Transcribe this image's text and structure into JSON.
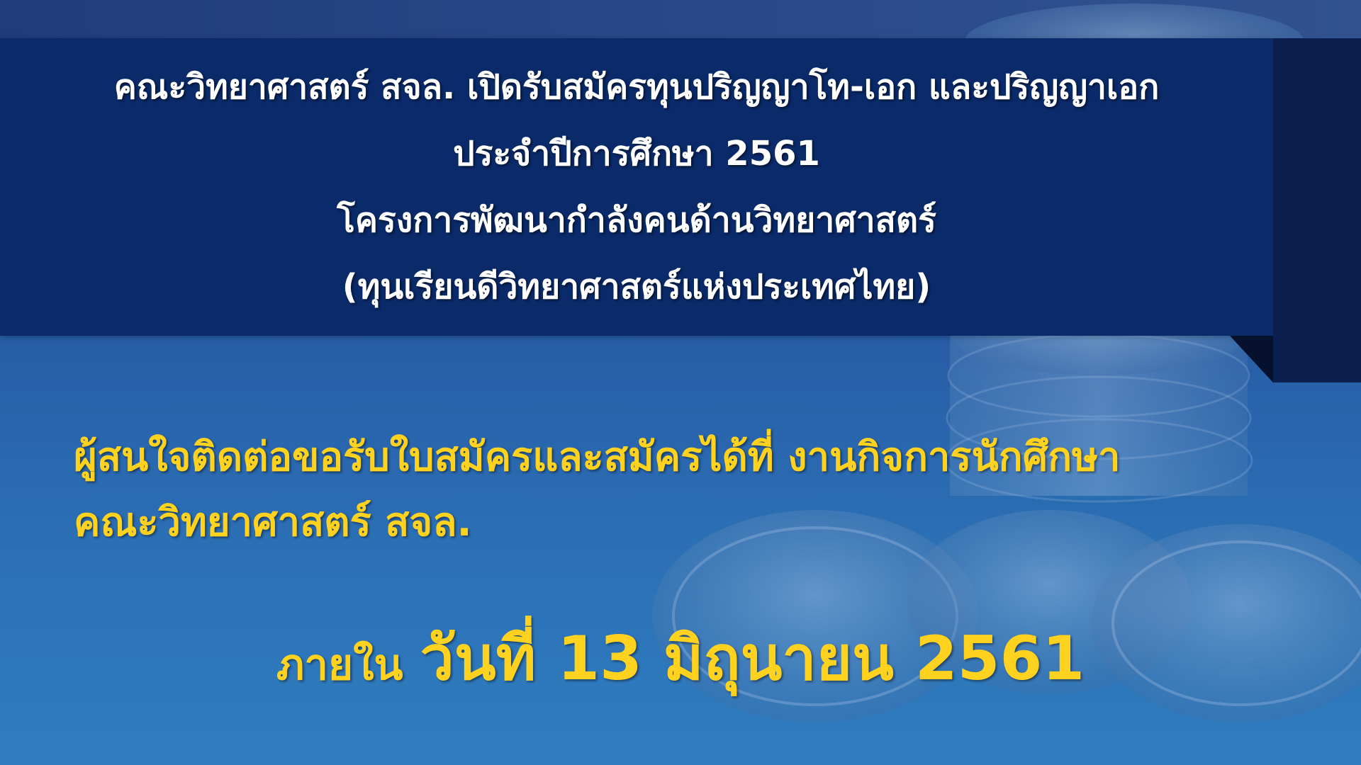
{
  "header": {
    "lines": [
      "คณะวิทยาศาสตร์ สจล. เปิดรับสมัครทุนปริญญาโท-เอก และปริญญาเอก",
      "ประจำปีการศึกษา 2561",
      "โครงการพัฒนากำลังคนด้านวิทยาศาสตร์",
      "(ทุนเรียนดีวิทยาศาสตร์แห่งประเทศไทย)"
    ]
  },
  "contact": {
    "lines": [
      "ผู้สนใจติดต่อขอรับใบสมัครและสมัครได้ที่ งานกิจการนักศึกษา",
      "คณะวิทยาศาสตร์ สจล."
    ]
  },
  "deadline": {
    "prefix": "ภายใน",
    "date": "วันที่ 13 มิถุนายน 2561"
  },
  "colors": {
    "banner": "#0a2a6a",
    "background": "#2656a0",
    "highlight_text": "#ffd21f",
    "banner_text": "#ffffff"
  },
  "background_image": "coins-illustration"
}
